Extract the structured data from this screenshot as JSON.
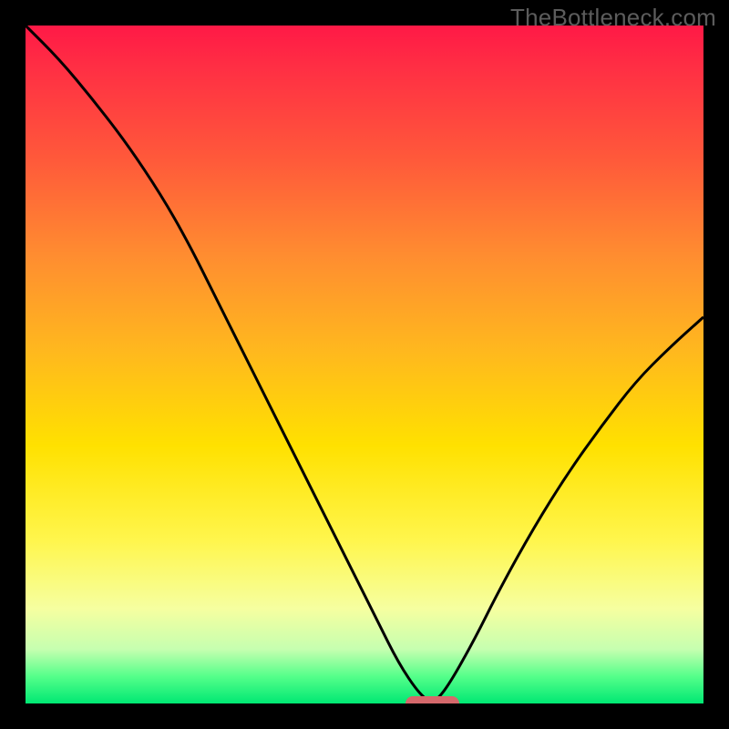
{
  "watermark": "TheBottleneck.com",
  "colors": {
    "black": "#000000",
    "watermark_text": "#5c5c5c",
    "curve": "#000000",
    "marker": "#d5686b",
    "gradient_top": "#ff1946",
    "gradient_bottom": "#00e873"
  },
  "chart_data": {
    "type": "line",
    "title": "",
    "xlabel": "",
    "ylabel": "",
    "xlim": [
      0,
      100
    ],
    "ylim": [
      0,
      100
    ],
    "grid": false,
    "legend": null,
    "series": [
      {
        "name": "bottleneck-curve",
        "x": [
          0,
          5,
          10,
          15,
          20,
          24,
          28,
          32,
          36,
          40,
          44,
          48,
          52,
          55,
          58,
          60,
          62,
          66,
          70,
          75,
          80,
          85,
          90,
          95,
          100
        ],
        "values": [
          100,
          95,
          89,
          82.5,
          75,
          68,
          60,
          52,
          44,
          36,
          28,
          20,
          12,
          6,
          1.5,
          0,
          2,
          9,
          17,
          26,
          34,
          41,
          47.5,
          52.5,
          57
        ]
      }
    ],
    "marker": {
      "x_start": 56,
      "x_end": 64,
      "y": 0,
      "label": ""
    },
    "annotations": []
  }
}
